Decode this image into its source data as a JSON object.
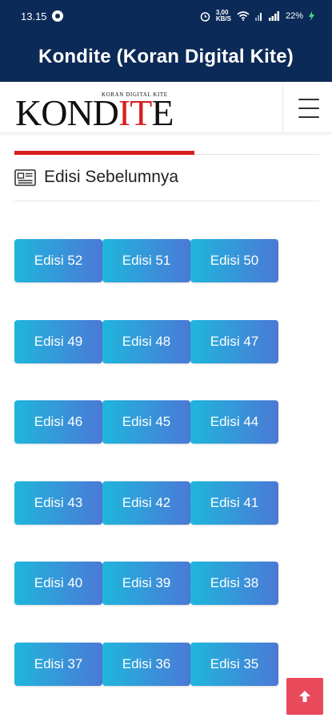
{
  "status_bar": {
    "time": "13.15",
    "net_speed_top": "3,00",
    "net_speed_bottom": "KB/S",
    "battery": "22%"
  },
  "app_bar": {
    "title": "Kondite (Koran Digital Kite)"
  },
  "site_header": {
    "logo_tagline": "KORAN DIGITAL KITE",
    "logo_part1": "KOND",
    "logo_part2": "IT",
    "logo_part3": "E"
  },
  "section": {
    "title": "Edisi Sebelumnya"
  },
  "editions": [
    [
      "Edisi 52",
      "Edisi 51",
      "Edisi 50"
    ],
    [
      "Edisi 49",
      "Edisi 48",
      "Edisi 47"
    ],
    [
      "Edisi 46",
      "Edisi 45",
      "Edisi 44"
    ],
    [
      "Edisi 43",
      "Edisi 42",
      "Edisi 41"
    ],
    [
      "Edisi 40",
      "Edisi 39",
      "Edisi 38"
    ],
    [
      "Edisi 37",
      "Edisi 36",
      "Edisi 35"
    ]
  ],
  "colors": {
    "app_bar": "#0c2a57",
    "accent_red": "#d81e1e",
    "button_gradient_start": "#1fb6dc",
    "button_gradient_end": "#4b79d6",
    "scroll_top": "#e84a5b"
  },
  "icons": {
    "section": "newspaper-icon",
    "menu": "hamburger-menu-icon",
    "scroll_top": "arrow-up-icon"
  }
}
